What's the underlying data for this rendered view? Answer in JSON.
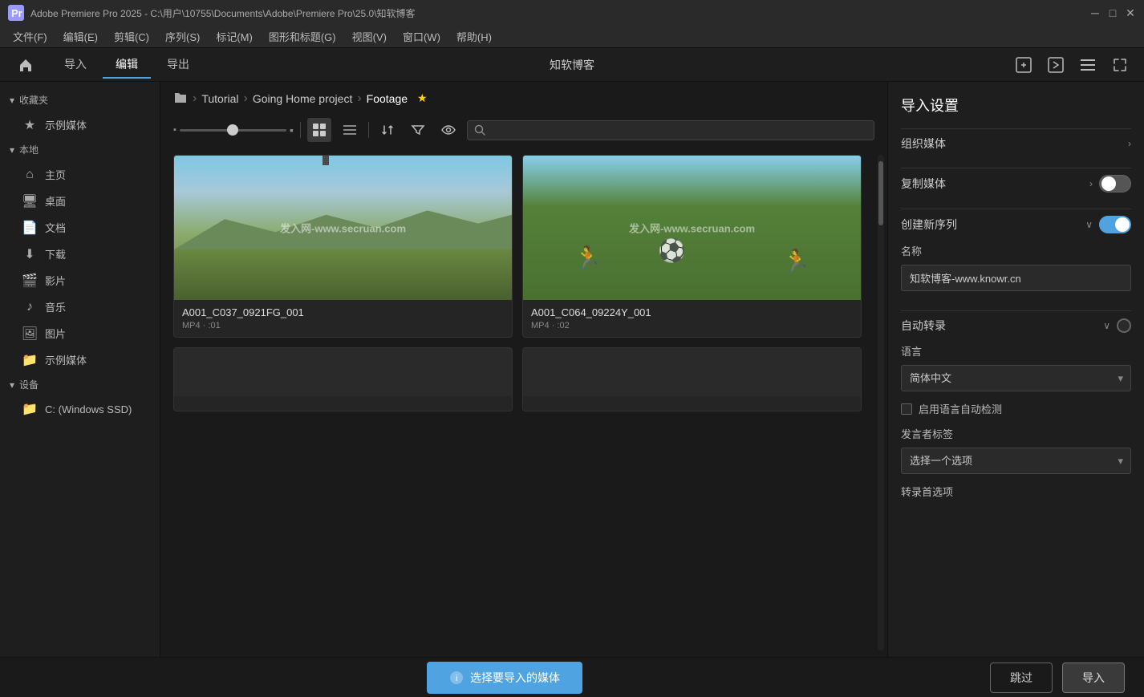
{
  "window": {
    "title": "Adobe Premiere Pro 2025 - C:\\用户\\10755\\Documents\\Adobe\\Premiere Pro\\25.0\\知软博客",
    "app_icon": "Pr"
  },
  "menu": {
    "items": [
      "文件(F)",
      "编辑(E)",
      "剪辑(C)",
      "序列(S)",
      "标记(M)",
      "图形和标题(G)",
      "视图(V)",
      "窗口(W)",
      "帮助(H)"
    ]
  },
  "navbar": {
    "home_icon": "⌂",
    "tabs": [
      "导入",
      "编辑",
      "导出"
    ],
    "active_tab": "导入",
    "app_title": "知软博客",
    "icons": [
      "import-icon",
      "export-icon",
      "layout-icon",
      "expand-icon"
    ]
  },
  "sidebar": {
    "collections_label": "收藏夹",
    "sample_media_label": "示例媒体",
    "local_label": "本地",
    "local_items": [
      {
        "label": "主页",
        "icon": "home"
      },
      {
        "label": "桌面",
        "icon": "desktop"
      },
      {
        "label": "文档",
        "icon": "file"
      },
      {
        "label": "下载",
        "icon": "download"
      },
      {
        "label": "影片",
        "icon": "movie"
      },
      {
        "label": "音乐",
        "icon": "music"
      },
      {
        "label": "图片",
        "icon": "picture"
      },
      {
        "label": "示例媒体",
        "icon": "folder"
      }
    ],
    "devices_label": "设备",
    "device_items": [
      {
        "label": "C: (Windows SSD)",
        "icon": "drive"
      }
    ]
  },
  "breadcrumb": {
    "folder_icon": "📁",
    "items": [
      "Tutorial",
      "Going Home project",
      "Footage"
    ],
    "star": "★"
  },
  "toolbar": {
    "view_grid": "⊞",
    "view_list": "☰",
    "sort": "⇅",
    "filter": "▽",
    "visibility": "◉",
    "search_placeholder": ""
  },
  "media_grid": {
    "items": [
      {
        "name": "A001_C037_0921FG_001",
        "type": "MP4",
        "duration": ":01",
        "thumb": "cross"
      },
      {
        "name": "A001_C064_09224Y_001",
        "type": "MP4",
        "duration": ":02",
        "thumb": "soccer"
      },
      {
        "name": "",
        "type": "",
        "duration": "",
        "thumb": "dark1"
      },
      {
        "name": "",
        "type": "",
        "duration": "",
        "thumb": "dark2"
      }
    ],
    "watermark": "发入网-www.secruan.com"
  },
  "right_panel": {
    "title": "导入设置",
    "sections": [
      {
        "label": "组织媒体",
        "expanded": false,
        "toggle": null,
        "arrow": "›"
      },
      {
        "label": "复制媒体",
        "expanded": false,
        "toggle": "off",
        "arrow": "›"
      },
      {
        "label": "创建新序列",
        "expanded": true,
        "toggle": "on",
        "arrow": "∨"
      }
    ],
    "name_label": "名称",
    "name_value": "知软博客-www.knowr.cn",
    "auto_transcribe": {
      "label": "自动转录",
      "expanded": true,
      "toggle_label": "off",
      "arrow": "∨"
    },
    "language_label": "语言",
    "language_value": "简体中文",
    "auto_detect_label": "启用语言自动检测",
    "speaker_label": "发言者标签",
    "speaker_placeholder": "选择一个选项",
    "transcribe_options_label": "转录首选项"
  },
  "bottom": {
    "status_btn_label": "选择要导入的媒体",
    "skip_label": "跳过",
    "import_label": "导入"
  }
}
